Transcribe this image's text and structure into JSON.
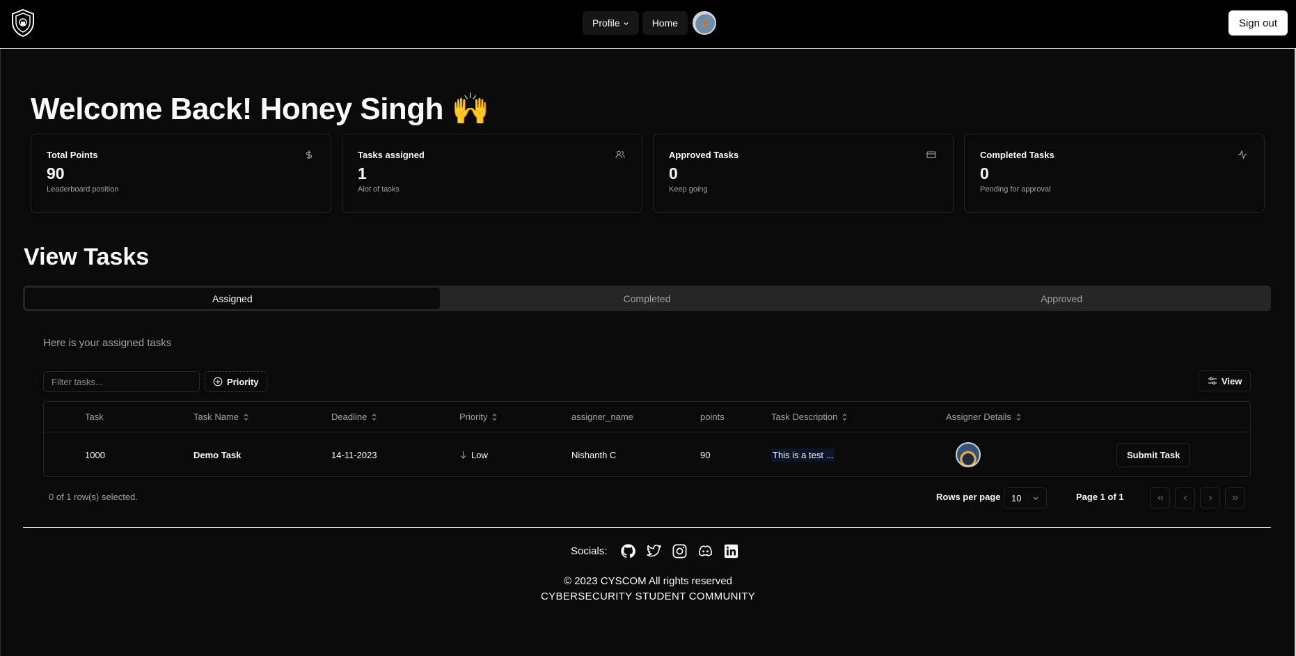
{
  "nav": {
    "profile_label": "Profile",
    "home_label": "Home",
    "signout_label": "Sign out"
  },
  "welcome": {
    "text": "Welcome Back! Honey Singh 🙌"
  },
  "cards": [
    {
      "title": "Total Points",
      "value": "90",
      "sub": "Leaderboard position",
      "icon": "dollar-icon"
    },
    {
      "title": "Tasks assigned",
      "value": "1",
      "sub": "Alot of tasks",
      "icon": "users-icon"
    },
    {
      "title": "Approved Tasks",
      "value": "0",
      "sub": "Keep going",
      "icon": "credit-card-icon"
    },
    {
      "title": "Completed Tasks",
      "value": "0",
      "sub": "Pending for approval",
      "icon": "activity-icon"
    }
  ],
  "tasks": {
    "title": "View Tasks",
    "tabs": [
      "Assigned",
      "Completed",
      "Approved"
    ],
    "active_tab": "Assigned",
    "subtitle": "Here is your assigned tasks",
    "filter_placeholder": "Filter tasks...",
    "priority_label": "Priority",
    "view_label": "View"
  },
  "table": {
    "headers": {
      "task": "Task",
      "task_name": "Task Name",
      "deadline": "Deadline",
      "priority": "Priority",
      "assigner_name": "assigner_name",
      "points": "points",
      "description": "Task Description",
      "assigner_details": "Assigner Details"
    },
    "rows": [
      {
        "task": "1000",
        "task_name": "Demo Task",
        "deadline": "14-11-2023",
        "priority": "Low",
        "assigner_name": "Nishanth C",
        "points": "90",
        "description": "This is a test ...",
        "submit_label": "Submit Task"
      }
    ]
  },
  "pagination": {
    "selected_text": "0 of 1 row(s) selected.",
    "rows_per_page_label": "Rows per page",
    "rows_per_page_value": "10",
    "page_info": "Page 1 of 1"
  },
  "footer": {
    "socials_label": "Socials:",
    "social_icons": [
      "github-icon",
      "twitter-icon",
      "instagram-icon",
      "discord-icon",
      "linkedin-icon"
    ],
    "copyright": "© 2023 CYSCOM All rights reserved",
    "community": "CYBERSECURITY STUDENT COMMUNITY"
  }
}
